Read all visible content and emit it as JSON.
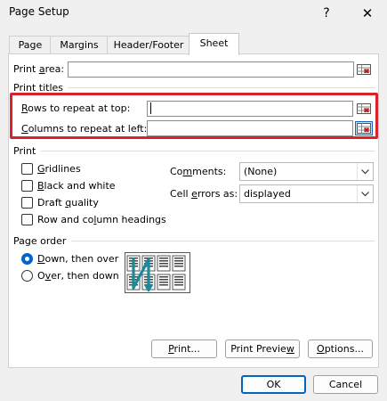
{
  "window": {
    "title": "Page Setup",
    "help_glyph": "?",
    "close_glyph": "✕"
  },
  "tabs": [
    {
      "label": "Page"
    },
    {
      "label": "Margins"
    },
    {
      "label": "Header/Footer"
    },
    {
      "label": "Sheet",
      "selected": true
    }
  ],
  "print_area": {
    "label_pre": "Print ",
    "label_key": "a",
    "label_post": "rea:",
    "value": ""
  },
  "print_titles": {
    "heading": "Print titles",
    "rows": {
      "label_key": "R",
      "label_post": "ows to repeat at top:",
      "value": ""
    },
    "columns": {
      "label_key": "C",
      "label_post": "olumns to repeat at left:",
      "value": ""
    }
  },
  "print_section": {
    "heading": "Print",
    "checkboxes": [
      {
        "pre": "",
        "key": "G",
        "post": "ridlines",
        "checked": false
      },
      {
        "pre": "",
        "key": "B",
        "post": "lack and white",
        "checked": false
      },
      {
        "pre": "Draft ",
        "key": "q",
        "post": "uality",
        "checked": false
      },
      {
        "pre": "Row and co",
        "key": "l",
        "post": "umn headings",
        "checked": false
      }
    ],
    "comments": {
      "label_pre": "Co",
      "label_key": "m",
      "label_post": "ments:",
      "value": "(None)"
    },
    "cell_errors": {
      "label_pre": "Cell ",
      "label_key": "e",
      "label_post": "rrors as:",
      "value": "displayed"
    }
  },
  "page_order": {
    "heading": "Page order",
    "options": [
      {
        "pre": "",
        "key": "D",
        "post": "own, then over",
        "selected": true
      },
      {
        "pre": "O",
        "key": "v",
        "post": "er, then down",
        "selected": false
      }
    ]
  },
  "buttons": {
    "print": {
      "pre": "",
      "key": "P",
      "post": "rint..."
    },
    "print_preview": {
      "pre": "Print Previe",
      "key": "w",
      "post": ""
    },
    "options": {
      "pre": "",
      "key": "O",
      "post": "ptions..."
    },
    "ok": "OK",
    "cancel": "Cancel"
  },
  "colors": {
    "accent": "#0066cc",
    "highlight_border": "#d8232a",
    "dialog_bg": "#f0f0f0"
  }
}
